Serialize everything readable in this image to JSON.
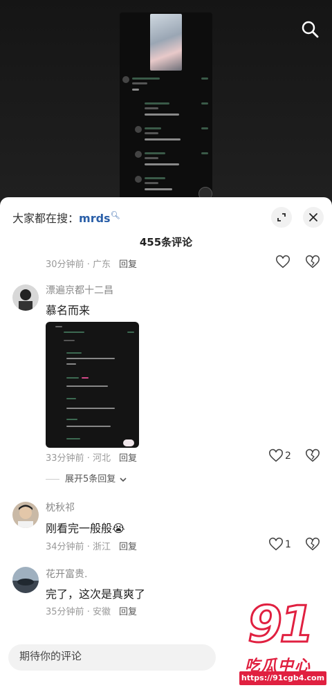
{
  "hot_search": {
    "prefix": "大家都在搜：",
    "keyword": "mrds"
  },
  "comment_count": "455条评论",
  "first_meta": {
    "time": "30分钟前",
    "sep": "·",
    "location": "广东",
    "reply": "回复"
  },
  "comments": [
    {
      "user": "漂遍京都十二昌",
      "text": "慕名而来",
      "time": "33分钟前",
      "location": "河北",
      "reply": "回复",
      "likes": "2",
      "expand": "展开5条回复"
    },
    {
      "user": "枕秋祁",
      "text": "刚看完一般般",
      "emoji": "😭",
      "time": "34分钟前",
      "location": "浙江",
      "reply": "回复",
      "likes": "1"
    },
    {
      "user": "花开富贵.",
      "text": "完了，这次是真爽了",
      "time": "35分钟前",
      "location": "安徽",
      "reply": "回复"
    }
  ],
  "input": {
    "placeholder": "期待你的评论"
  },
  "watermark": {
    "number": "91",
    "name": "吃瓜中心",
    "url": "https://91cgb4.com"
  },
  "icons": {
    "search": "search-icon",
    "expand": "expand-icon",
    "close": "close-icon",
    "heart": "heart-icon",
    "dislike": "broken-heart-icon",
    "chevron": "chevron-down-icon"
  },
  "colors": {
    "accent": "#2a5fa8",
    "brand_red": "#e02040"
  }
}
